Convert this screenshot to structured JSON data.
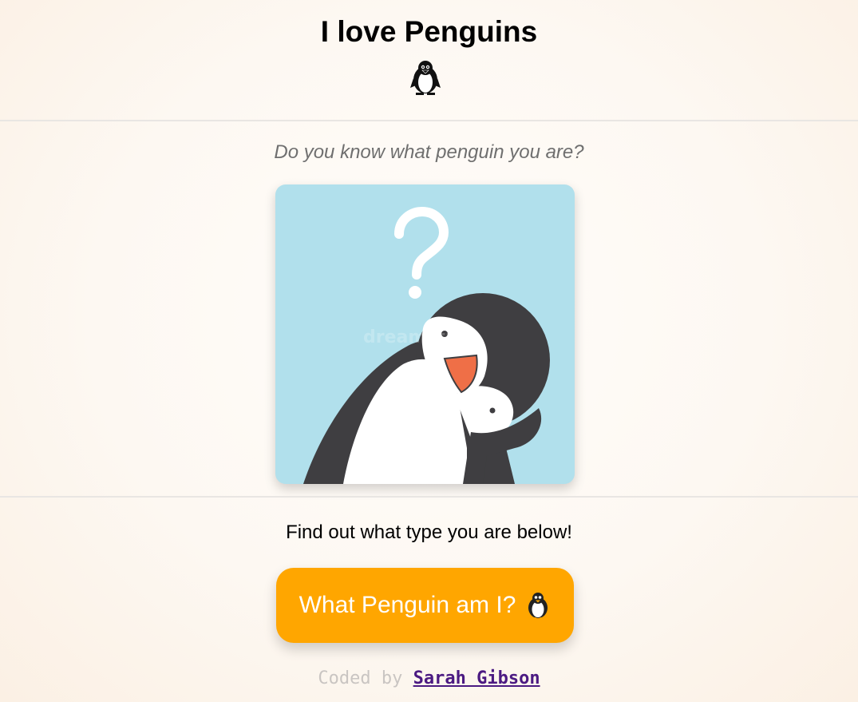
{
  "header": {
    "title": "I love Penguins",
    "title_icon": "penguin-icon"
  },
  "main": {
    "tagline": "Do you know what penguin you are?",
    "image": {
      "description_icon": "thinking-penguin-illustration",
      "watermark": "dreamstime"
    },
    "find_text": "Find out what type you are below!",
    "cta_label": "What Penguin am I?",
    "cta_icon": "penguin-icon"
  },
  "footer": {
    "prefix": "Coded by",
    "author": "Sarah Gibson"
  },
  "colors": {
    "button_bg": "#ffa600",
    "card_bg": "#b1e0ec",
    "link": "#4b1a82",
    "penguin_dark": "#3f3e41",
    "beak": "#ef6f47"
  }
}
